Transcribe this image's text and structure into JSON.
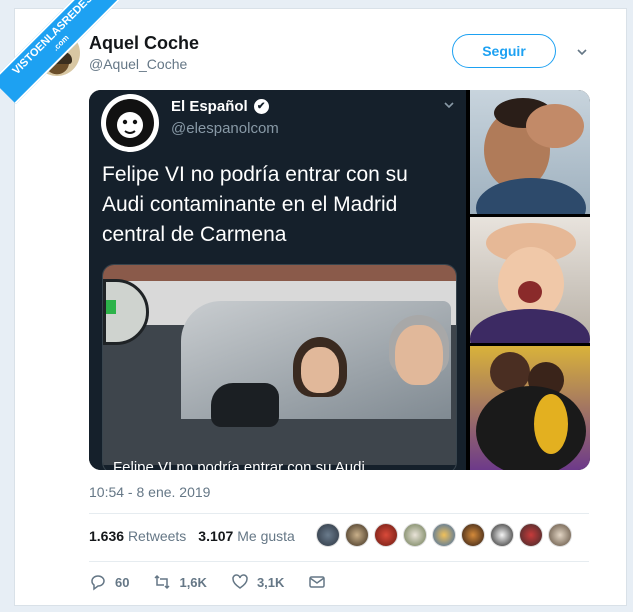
{
  "watermark": {
    "text": "VISTOENLASREDES",
    "sub": ".com"
  },
  "tweet": {
    "author_name": "Aquel Coche",
    "author_handle": "@Aquel_Coche",
    "follow_label": "Seguir",
    "timestamp": "10:54 - 8 ene. 2019",
    "retweets_count": "1.636",
    "retweets_label": "Retweets",
    "likes_count": "3.107",
    "likes_label": "Me gusta",
    "reply_count": "60",
    "retweet_count_action": "1,6K",
    "like_count_action": "3,1K"
  },
  "quoted": {
    "name": "El Español",
    "handle": "@elespanolcom",
    "text": "Felipe VI no podría entrar con su Audi contaminante en el Madrid central de Carmena",
    "card_title": "Felipe VI no podría entrar con su Audi"
  },
  "colors": {
    "accent": "#1da1f2",
    "dark_bg": "#15202b"
  }
}
